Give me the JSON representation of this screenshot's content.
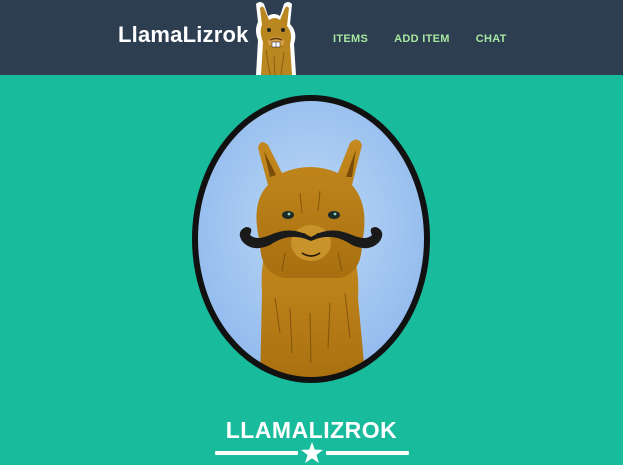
{
  "navbar": {
    "brand": "LlamaLizrok",
    "links": [
      {
        "label": "ITEMS"
      },
      {
        "label": "ADD ITEM"
      },
      {
        "label": "CHAT"
      }
    ]
  },
  "hero": {
    "title": "LLAMALIZROK"
  },
  "icons": {
    "logo": "llama-logo-icon",
    "portrait": "mustache-llama-portrait",
    "divider": "star-icon"
  },
  "colors": {
    "navbar_bg": "#2c3e50",
    "page_bg": "#18bc9c",
    "nav_link": "#a8e6a1",
    "brand_text": "#ffffff"
  }
}
